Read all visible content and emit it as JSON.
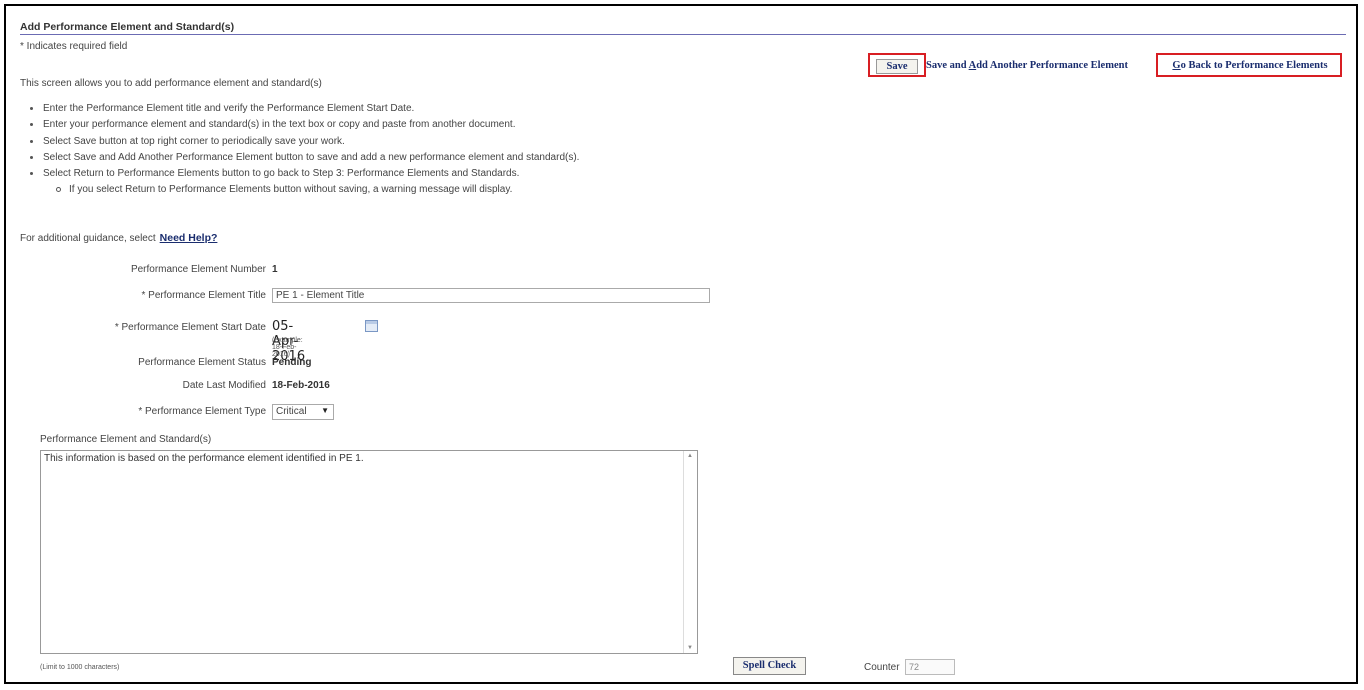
{
  "page": {
    "title": "Add Performance Element and Standard(s)",
    "required_note": "* Indicates required field",
    "intro": "This screen allows you to add performance element and standard(s)"
  },
  "buttons": {
    "save": "Save",
    "save_add_prefix": "Save and ",
    "save_add_key": "A",
    "save_add_suffix": "dd Another Performance Element",
    "go_back_key": "G",
    "go_back_suffix": "o Back to Performance Elements"
  },
  "instructions": [
    "Enter the Performance Element title and verify the Performance Element Start Date.",
    "Enter your performance element and standard(s) in the text box or copy and paste from another document.",
    "Select Save button at top right corner to periodically save your work.",
    "Select Save and Add Another Performance Element button to save and add a new performance element and standard(s).",
    "Select Return to Performance Elements button to go back to Step 3: Performance Elements and Standards.",
    "If you select Return to Performance Elements button without saving, a warning message will display."
  ],
  "guidance": {
    "text": "For additional guidance, select",
    "link": "Need Help?"
  },
  "form": {
    "number_label": "Performance Element Number",
    "number_value": "1",
    "title_label": "* Performance Element Title",
    "title_value": "PE 1 - Element Title",
    "start_label": "* Performance Element Start Date",
    "start_value": "05-Apr-2016",
    "start_example": "(example: 18-Feb-2016)",
    "status_label": "Performance Element Status",
    "status_value": "Pending",
    "modified_label": "Date Last Modified",
    "modified_value": "18-Feb-2016",
    "type_label": "* Performance Element Type",
    "type_value": "Critical"
  },
  "standards": {
    "label": "Performance Element and Standard(s)",
    "text": "This information is based on the performance element identified in PE 1.",
    "limit": "(Limit to 1000 characters)",
    "spell_check": "Spell Check",
    "counter_label": "Counter",
    "counter_value": "72"
  },
  "colors": {
    "highlight": "#d81e23",
    "button_text": "#1a2d6e",
    "title_rule": "#6b6bb3"
  }
}
